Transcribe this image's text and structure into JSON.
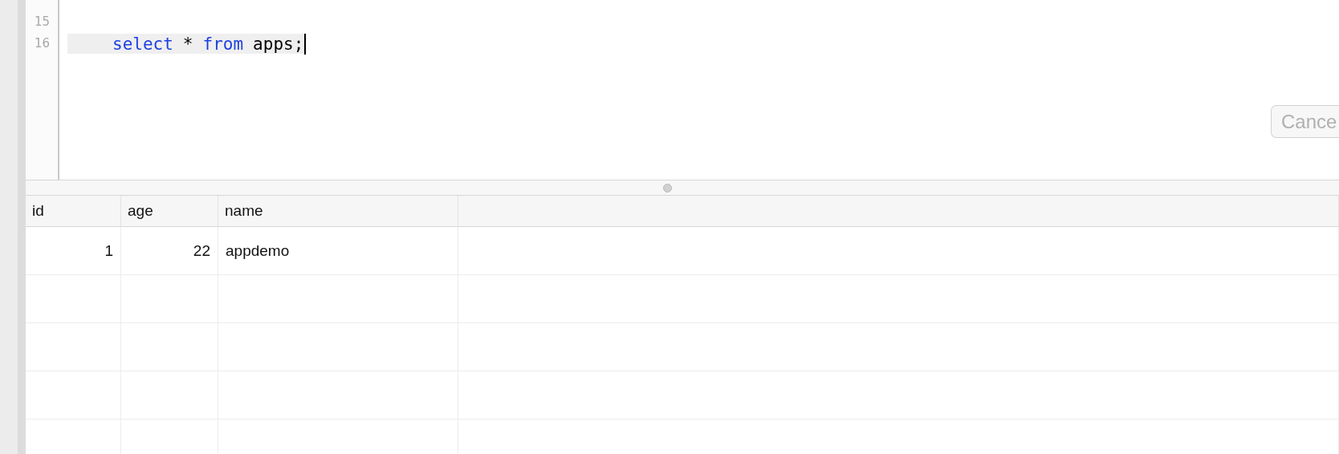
{
  "editor": {
    "lines": [
      {
        "number": "15"
      },
      {
        "number": "16",
        "current": true,
        "tokens": [
          {
            "kind": "keyword",
            "text": "select"
          },
          {
            "kind": "operator",
            "text": "*"
          },
          {
            "kind": "keyword",
            "text": "from"
          },
          {
            "kind": "identifier",
            "text": "apps;"
          }
        ]
      }
    ],
    "cancel_button": {
      "label": "Cance",
      "disabled": true
    }
  },
  "table": {
    "columns": [
      {
        "label": "id",
        "numeric": true
      },
      {
        "label": "age",
        "numeric": true
      },
      {
        "label": "name",
        "numeric": false
      }
    ],
    "rows": [
      {
        "cells": [
          "1",
          "22",
          "appdemo"
        ]
      }
    ]
  }
}
